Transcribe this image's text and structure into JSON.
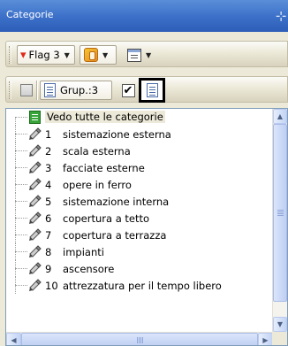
{
  "panel": {
    "title": "Categorie",
    "pin_glyph": "⊹"
  },
  "toolbar1": {
    "flag_label": "Flag 3",
    "flag_glyph": "▾",
    "caret": "▼"
  },
  "toolbar2": {
    "group_label": "Grup.:3",
    "check_glyph": "✔"
  },
  "tree": {
    "root_label": "Vedo tutte le categorie",
    "items": [
      {
        "num": "1",
        "name": "sistemazione esterna"
      },
      {
        "num": "2",
        "name": "scala esterna"
      },
      {
        "num": "3",
        "name": "facciate esterne"
      },
      {
        "num": "4",
        "name": "opere in ferro"
      },
      {
        "num": "5",
        "name": "sistemazione interna"
      },
      {
        "num": "6",
        "name": "copertura a tetto"
      },
      {
        "num": "7",
        "name": "copertura a terrazza"
      },
      {
        "num": "8",
        "name": "impianti"
      },
      {
        "num": "9",
        "name": "ascensore"
      },
      {
        "num": "10",
        "name": "attrezzatura per il tempo libero"
      }
    ],
    "item_icon": "pencil-tag-icon"
  },
  "scrollbars": {
    "up": "▲",
    "down": "▼",
    "left": "◀",
    "right": "▶"
  },
  "colors": {
    "titlebar": "#3b6fc8",
    "toolbar_face": "#ece9d8",
    "tree_border": "#7f9db9",
    "selected_root_bg": "#ece9d8",
    "scroll_thumb": "#c3d3f5"
  }
}
